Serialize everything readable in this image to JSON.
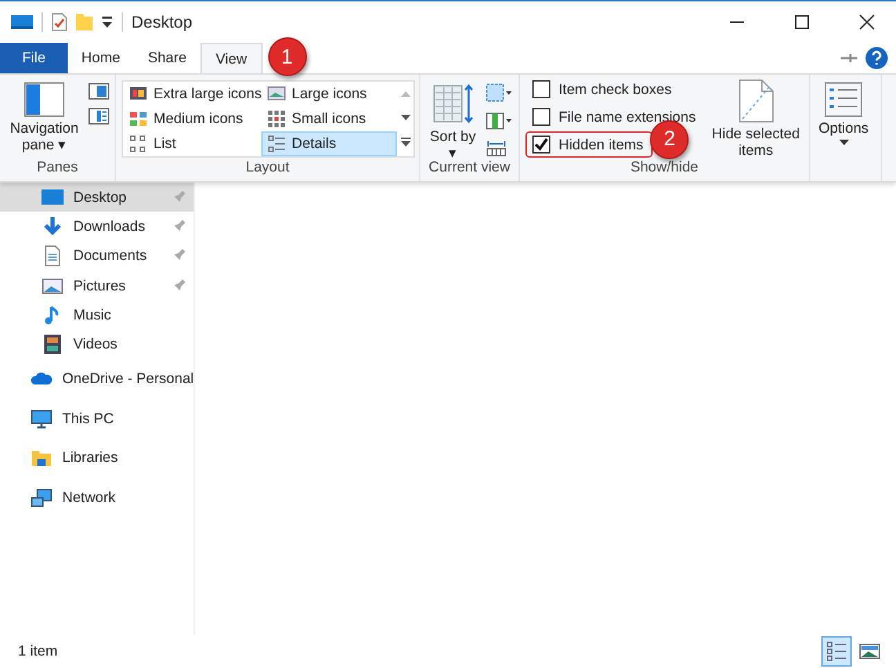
{
  "window": {
    "title": "Desktop"
  },
  "tabs": [
    {
      "label": "File",
      "kind": "file",
      "selected": false
    },
    {
      "label": "Home",
      "kind": "tab",
      "selected": false
    },
    {
      "label": "Share",
      "kind": "tab",
      "selected": false
    },
    {
      "label": "View",
      "kind": "tab",
      "selected": true
    }
  ],
  "ribbon": {
    "panes": {
      "label": "Panes",
      "navigation_pane": "Navigation pane ▾"
    },
    "layout": {
      "label": "Layout",
      "options": [
        {
          "label": "Extra large icons",
          "selected": false
        },
        {
          "label": "Large icons",
          "selected": false
        },
        {
          "label": "Medium icons",
          "selected": false
        },
        {
          "label": "Small icons",
          "selected": false
        },
        {
          "label": "List",
          "selected": false
        },
        {
          "label": "Details",
          "selected": true
        }
      ]
    },
    "current_view": {
      "label": "Current view",
      "sort": "Sort by ▾"
    },
    "show_hide": {
      "label": "Show/hide",
      "checkboxes": [
        {
          "label": "Item check boxes",
          "checked": false
        },
        {
          "label": "File name extensions",
          "checked": false
        },
        {
          "label": "Hidden items",
          "checked": true
        }
      ],
      "hide_selected": "Hide selected items"
    },
    "options": {
      "label": "Options"
    }
  },
  "callouts": [
    "1",
    "2"
  ],
  "navigation": [
    {
      "label": "Desktop",
      "kind": "desktop",
      "pinned": true,
      "selected": true
    },
    {
      "label": "Downloads",
      "kind": "download",
      "pinned": true,
      "selected": false
    },
    {
      "label": "Documents",
      "kind": "document",
      "pinned": true,
      "selected": false
    },
    {
      "label": "Pictures",
      "kind": "picture",
      "pinned": true,
      "selected": false
    },
    {
      "label": "Music",
      "kind": "music",
      "pinned": false,
      "selected": false
    },
    {
      "label": "Videos",
      "kind": "video",
      "pinned": false,
      "selected": false
    },
    {
      "label": "OneDrive - Personal",
      "kind": "cloud",
      "pinned": false,
      "selected": false
    },
    {
      "label": "This PC",
      "kind": "pc",
      "pinned": false,
      "selected": false
    },
    {
      "label": "Libraries",
      "kind": "folder",
      "pinned": false,
      "selected": false
    },
    {
      "label": "Network",
      "kind": "network",
      "pinned": false,
      "selected": false
    }
  ],
  "status_bar": {
    "text": "1 item",
    "views": [
      {
        "kind": "details",
        "selected": true
      },
      {
        "kind": "thumbnails",
        "selected": false
      }
    ]
  }
}
